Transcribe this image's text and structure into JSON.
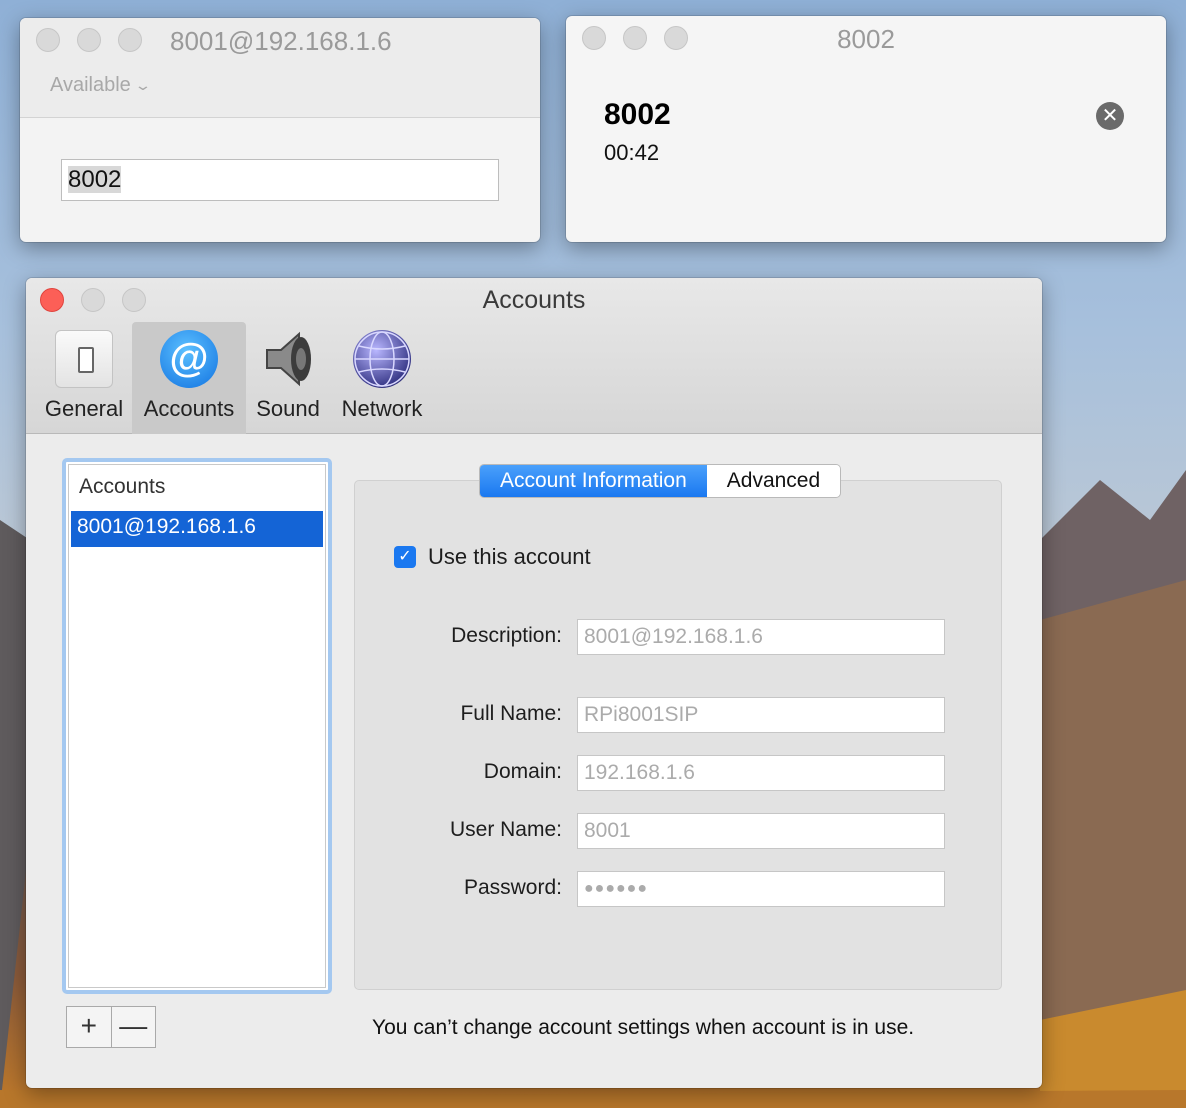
{
  "dialer": {
    "title": "8001@192.168.1.6",
    "status": "Available",
    "number": "8002"
  },
  "call": {
    "title": "8002",
    "caller": "8002",
    "duration": "00:42"
  },
  "prefs": {
    "title": "Accounts",
    "toolbar": [
      {
        "label": "General",
        "icon": "switch-icon"
      },
      {
        "label": "Accounts",
        "icon": "at-icon"
      },
      {
        "label": "Sound",
        "icon": "speaker-icon"
      },
      {
        "label": "Network",
        "icon": "globe-icon"
      }
    ],
    "accounts_list": {
      "header": "Accounts",
      "items": [
        "8001@192.168.1.6"
      ]
    },
    "tabs": [
      "Account Information",
      "Advanced"
    ],
    "use_account_label": "Use this account",
    "fields": {
      "description": {
        "label": "Description:",
        "value": "8001@192.168.1.6"
      },
      "full_name": {
        "label": "Full Name:",
        "value": "RPi8001SIP"
      },
      "domain": {
        "label": "Domain:",
        "value": "192.168.1.6"
      },
      "user_name": {
        "label": "User Name:",
        "value": "8001"
      },
      "password": {
        "label": "Password:",
        "value": "●●●●●●"
      }
    },
    "notice": "You can’t change account settings when account is in use.",
    "add_symbol": "+",
    "remove_symbol": "—"
  }
}
